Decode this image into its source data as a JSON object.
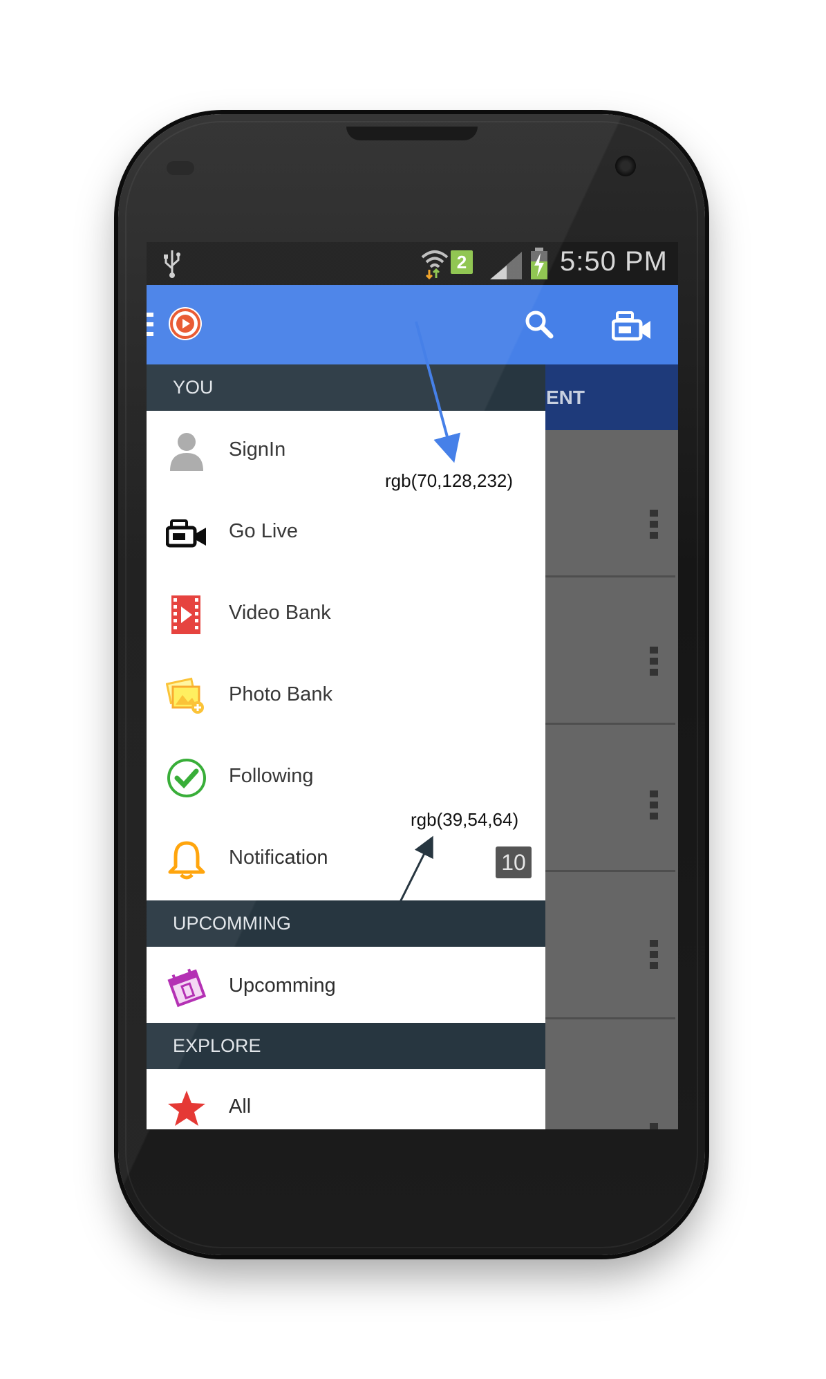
{
  "status_bar": {
    "sim_slot": "2",
    "time": "5:50 PM"
  },
  "app_bar": {
    "icons": [
      "menu-icon",
      "app-logo-icon",
      "search-icon",
      "video-camera-icon"
    ],
    "color": "#4680e8"
  },
  "background": {
    "tab_partial_label": "ENT"
  },
  "drawer": {
    "sections": [
      {
        "header": "YOU",
        "items": [
          {
            "label": "SignIn",
            "icon": "user-icon"
          },
          {
            "label": "Go Live",
            "icon": "video-camera-icon"
          },
          {
            "label": "Video Bank",
            "icon": "video-file-icon"
          },
          {
            "label": "Photo Bank",
            "icon": "photo-add-icon"
          },
          {
            "label": "Following",
            "icon": "check-circle-icon"
          },
          {
            "label": "Notification",
            "icon": "bell-icon",
            "badge": "10"
          }
        ]
      },
      {
        "header": "UPCOMMING",
        "items": [
          {
            "label": "Upcomming",
            "icon": "calendar-icon"
          }
        ]
      },
      {
        "header": "EXPLORE",
        "items": [
          {
            "label": "All",
            "icon": "star-icon"
          }
        ]
      }
    ],
    "header_color": "#273640"
  },
  "annotations": {
    "appbar_color": "rgb(70,128,232)",
    "header_color": "rgb(39,54,64)"
  }
}
